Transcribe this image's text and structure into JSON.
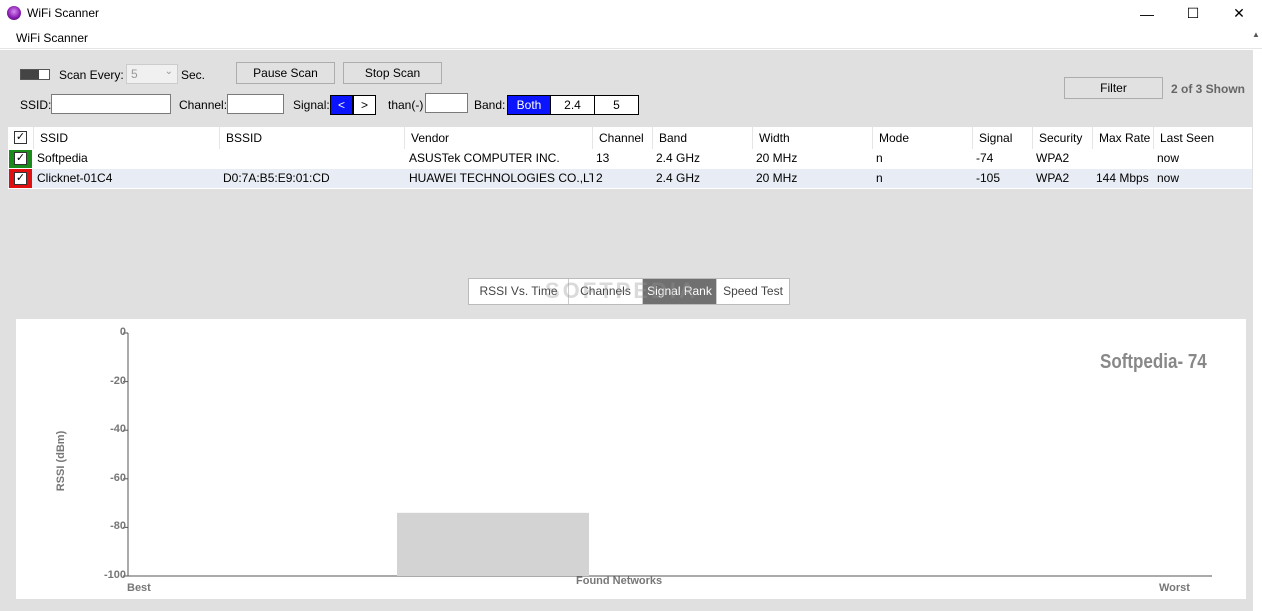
{
  "window": {
    "title": "WiFi Scanner"
  },
  "menu": {
    "items": [
      "WiFi Scanner"
    ]
  },
  "controls": {
    "scan_every_label": "Scan Every:",
    "scan_every_value": "5",
    "sec_label": "Sec.",
    "pause_button": "Pause Scan",
    "stop_button": "Stop Scan",
    "ssid_label": "SSID:",
    "channel_label": "Channel:",
    "signal_label": "Signal:",
    "signal_lt": "<",
    "signal_gt": ">",
    "than_label": "than(-)",
    "band_label": "Band:",
    "band_options": [
      "Both",
      "2.4",
      "5"
    ],
    "filter_button": "Filter",
    "shown_count": "2 of 3 Shown"
  },
  "table": {
    "columns": [
      "SSID",
      "BSSID",
      "Vendor",
      "Channel",
      "Band",
      "Width",
      "Mode",
      "Signal",
      "Security",
      "Max Rate",
      "Last Seen"
    ],
    "rows": [
      {
        "color": "#1a8a1a",
        "cells": [
          "Softpedia",
          "",
          "ASUSTek COMPUTER INC.",
          "13",
          "2.4 GHz",
          "20 MHz",
          "n",
          "-74",
          "WPA2",
          "",
          "now"
        ]
      },
      {
        "color": "#e01010",
        "cells": [
          "Clicknet-01C4",
          "D0:7A:B5:E9:01:CD",
          "HUAWEI TECHNOLOGIES CO.,LTD",
          "2",
          "2.4 GHz",
          "20 MHz",
          "n",
          "-105",
          "WPA2",
          "144 Mbps",
          "now"
        ]
      }
    ]
  },
  "tabs": [
    {
      "label": "RSSI Vs. Time",
      "active": false
    },
    {
      "label": "Channels",
      "active": false
    },
    {
      "label": "Signal Rank",
      "active": true
    },
    {
      "label": "Speed Test",
      "active": false
    }
  ],
  "watermark": "SOFTPEDIA",
  "colors": {
    "accent": "#0a14ff",
    "active_tab": "#707070",
    "bar": "#d3d3d3"
  },
  "chart_data": {
    "type": "bar",
    "ylabel": "RSSI (dBm)",
    "xlabel": "Found Networks",
    "x_start_label": "Best",
    "x_end_label": "Worst",
    "ylim": [
      -100,
      0
    ],
    "yticks": [
      0,
      -20,
      -40,
      -60,
      -80,
      -100
    ],
    "categories": [
      "Softpedia"
    ],
    "values": [
      -74
    ],
    "annotation": "Softpedia- 74",
    "grid": false
  }
}
